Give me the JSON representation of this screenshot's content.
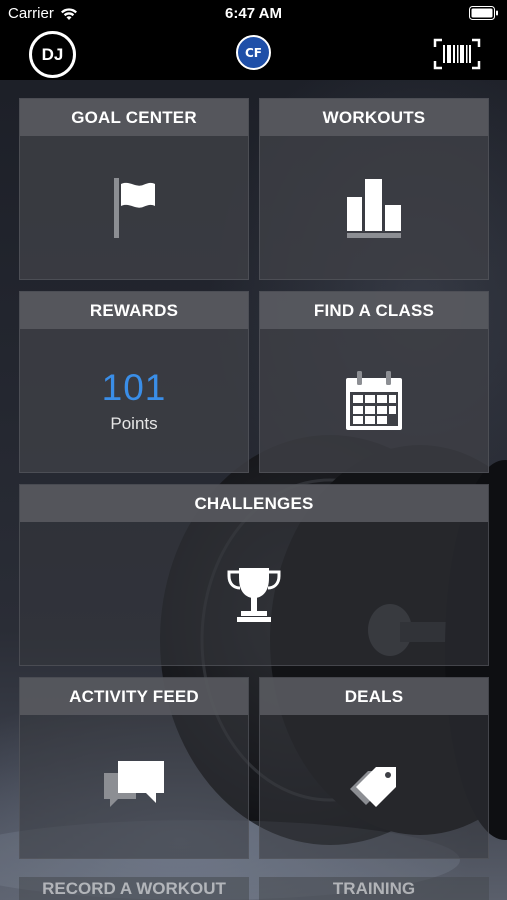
{
  "status_bar": {
    "carrier": "Carrier",
    "time": "6:47 AM"
  },
  "nav": {
    "avatar_initials": "DJ",
    "logo_text": "CF",
    "barcode_icon": "barcode-scan-icon"
  },
  "tiles": {
    "goal_center": {
      "label": "GOAL CENTER",
      "icon": "flag-icon"
    },
    "workouts": {
      "label": "WORKOUTS",
      "icon": "bar-chart-icon"
    },
    "rewards": {
      "label": "REWARDS",
      "points_value": "101",
      "points_label": "Points"
    },
    "find_a_class": {
      "label": "FIND A CLASS",
      "icon": "calendar-icon"
    },
    "challenges": {
      "label": "CHALLENGES",
      "icon": "trophy-icon"
    },
    "activity_feed": {
      "label": "ACTIVITY FEED",
      "icon": "chat-bubbles-icon"
    },
    "deals": {
      "label": "DEALS",
      "icon": "price-tag-icon"
    },
    "record_a_workout": {
      "label": "RECORD A WORKOUT"
    },
    "training": {
      "label": "TRAINING"
    }
  },
  "colors": {
    "points_accent": "#3a8ee8",
    "logo_blue": "#1f4fa8"
  }
}
